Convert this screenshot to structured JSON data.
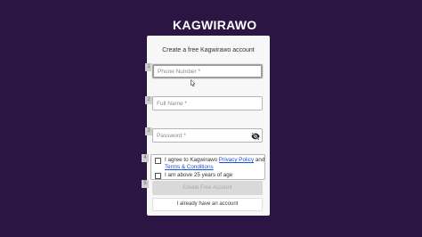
{
  "brand": {
    "name": "KAGWIRAWO"
  },
  "form": {
    "title": "Create a free Kagwirawo account",
    "steps": [
      "1",
      "2",
      "3",
      "4",
      "5"
    ],
    "phone": {
      "placeholder": "Phone Number *",
      "value": ""
    },
    "full_name": {
      "placeholder": "Full Name *",
      "value": ""
    },
    "password": {
      "placeholder": "Password *",
      "value": "",
      "toggle_icon": "eye-slash-icon"
    },
    "terms": {
      "prefix": "I agree to Kagwirawo ",
      "privacy_link": "Privacy Policy",
      "conjunction": " and ",
      "terms_link": "Terms & Conditions",
      "checked": false
    },
    "age": {
      "label": "I am above 25 years of age",
      "checked": false
    },
    "submit_label": "Create Free Account",
    "submit_enabled": false,
    "signin_label": "I already have an account"
  },
  "colors": {
    "background": "#2b1542",
    "card": "#f7f7f7",
    "link": "#1a4fd6",
    "disabled_button": "#d9d9d9"
  }
}
